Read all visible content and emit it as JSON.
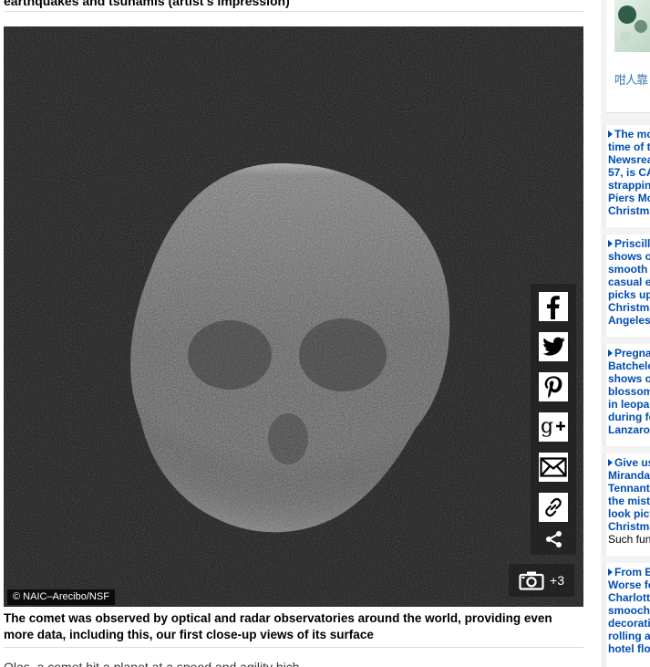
{
  "article": {
    "prev_caption": "earthquakes and tsunamis (artist's impression)",
    "image_credit": "© NAIC–Arecibo/NSF",
    "gallery_count": "+3",
    "caption": "The comet was observed by optical and radar observatories around the world, providing even more data, including this, our first close-up views of its surface",
    "next_text": "Olas, a comet hit a planet at a speed and agility hich"
  },
  "share": {
    "buttons": [
      {
        "name": "facebook-share-button",
        "icon": "facebook-icon"
      },
      {
        "name": "twitter-share-button",
        "icon": "twitter-icon"
      },
      {
        "name": "pinterest-share-button",
        "icon": "pinterest-icon"
      },
      {
        "name": "google-plus-share-button",
        "icon": "google-plus-icon"
      },
      {
        "name": "email-share-button",
        "icon": "email-icon"
      },
      {
        "name": "copy-link-button",
        "icon": "link-icon"
      }
    ],
    "more_icon": "share-icon"
  },
  "sidebar": {
    "ad_text": "咁人靠",
    "stories": [
      {
        "lines": [
          "The mo",
          "time of t",
          "Newsrea",
          "57, is CA",
          "strappin",
          "Piers Mo",
          "Christma"
        ]
      },
      {
        "lines": [
          "Priscill",
          "shows o",
          "smooth",
          "casual e",
          "picks up",
          "Christma",
          "Angeles"
        ]
      },
      {
        "lines": [
          "Pregna",
          "Batchelo",
          "shows o",
          "blossom",
          "in leopa",
          "during fe",
          "Lanzaro"
        ]
      },
      {
        "lines": [
          "Give us",
          "Miranda",
          "Tennant",
          "the mist",
          "look pict",
          "Christma"
        ],
        "sub": "Such fun"
      },
      {
        "lines": [
          "From E",
          "Worse fo",
          "Charlott",
          "smooch",
          "decorati",
          "rolling a",
          "hotel flo"
        ]
      }
    ]
  }
}
